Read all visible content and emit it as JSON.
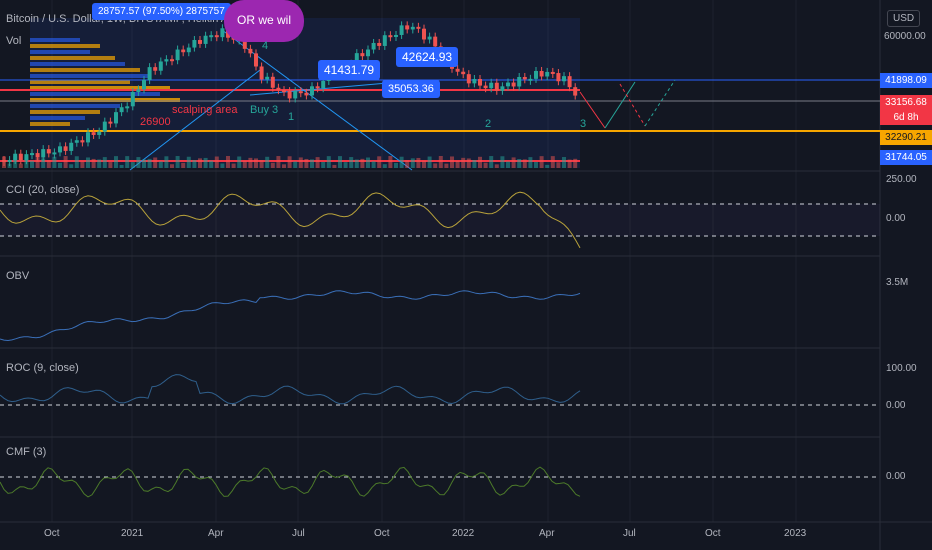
{
  "header": {
    "symbol": "Bitcoin / U.S. Dollar, 1W, BITSTAMP, Heikin Ashi",
    "vol_label": "Vol",
    "currency": "USD",
    "note_bubble": "OR we  wil"
  },
  "annotations": {
    "top_price_label": "28757.57 (97.50%) 2875757",
    "price_bubble_1": "41431.79",
    "price_bubble_2": "42624.93",
    "price_bubble_3": "35053.36",
    "scalping": "scalping area",
    "level_26900": "26900",
    "buy3": "Buy 3",
    "wave_1": "1",
    "wave_2": "2",
    "wave_3": "3",
    "wave_4": "4"
  },
  "price_axis": {
    "top_level": "60000.00",
    "tags": [
      {
        "value": "41898.09",
        "bg": "#2962ff",
        "fg": "#ffffff"
      },
      {
        "value": "33156.68",
        "bg": "#f23645",
        "fg": "#ffffff"
      },
      {
        "value": "6d 8h",
        "bg": "#f23645",
        "fg": "#ffffff"
      },
      {
        "value": "32290.21",
        "bg": "#f7a600",
        "fg": "#131722"
      },
      {
        "value": "31744.05",
        "bg": "#2962ff",
        "fg": "#ffffff"
      }
    ]
  },
  "panels": {
    "cci": {
      "title": "CCI (20, close)",
      "top_level": "250.00",
      "mid_level": "0.00"
    },
    "obv": {
      "title": "OBV",
      "level": "3.5M"
    },
    "roc": {
      "title": "ROC (9, close)",
      "top_level": "100.00",
      "mid_level": "0.00"
    },
    "cmf": {
      "title": "CMF (3)",
      "level": "0.00"
    }
  },
  "time_axis": [
    "Oct",
    "2021",
    "Apr",
    "Jul",
    "Oct",
    "2022",
    "Apr",
    "Jul",
    "Oct",
    "2023"
  ],
  "colors": {
    "up": "#26a69a",
    "down": "#ef5350",
    "accent": "#2962ff",
    "orange": "#f7a600",
    "purple": "#9c27b0"
  }
}
